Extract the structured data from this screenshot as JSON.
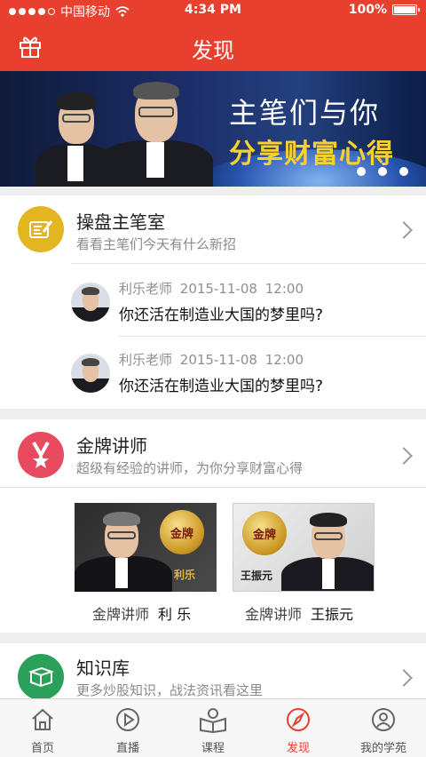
{
  "status_bar": {
    "carrier": "中国移动",
    "time": "4:34 PM",
    "battery": "100%"
  },
  "header": {
    "title": "发现",
    "left_icon": "gift-icon"
  },
  "banner": {
    "line1": "主笔们与你",
    "line2": "分享财富心得",
    "page_count": 3
  },
  "sections": {
    "caopan": {
      "title": "操盘主笔室",
      "subtitle": "看看主笔们今天有什么新招",
      "icon": "notebook-pen-icon",
      "color": "#e2b521",
      "posts": [
        {
          "author": "利乐老师",
          "date": "2015-11-08",
          "time": "12:00",
          "text": "你还活在制造业大国的梦里吗?"
        },
        {
          "author": "利乐老师",
          "date": "2015-11-08",
          "time": "12:00",
          "text": "你还活在制造业大国的梦里吗?"
        }
      ]
    },
    "gold": {
      "title": "金牌讲师",
      "subtitle": "超级有经验的讲师，为你分享财富心得",
      "icon": "ribbon-star-icon",
      "color": "#e84a5f",
      "teachers": [
        {
          "label": "金牌讲师",
          "name": "利 乐",
          "medal": "金牌",
          "card_name": "利乐"
        },
        {
          "label": "金牌讲师",
          "name": "王振元",
          "medal": "金牌",
          "card_name": "王振元"
        }
      ]
    },
    "knowledge": {
      "title": "知识库",
      "subtitle": "更多炒股知识，战法资讯看这里",
      "icon": "book-icon",
      "color": "#2aa05a"
    }
  },
  "tabbar": {
    "tabs": [
      {
        "label": "首页",
        "icon": "home-icon"
      },
      {
        "label": "直播",
        "icon": "play-circle-icon"
      },
      {
        "label": "课程",
        "icon": "open-book-icon"
      },
      {
        "label": "发现",
        "icon": "compass-icon",
        "active": true
      },
      {
        "label": "我的学苑",
        "icon": "user-circle-icon"
      }
    ]
  },
  "colors": {
    "brand": "#e8402e",
    "accent_gold": "#f9d12c"
  }
}
